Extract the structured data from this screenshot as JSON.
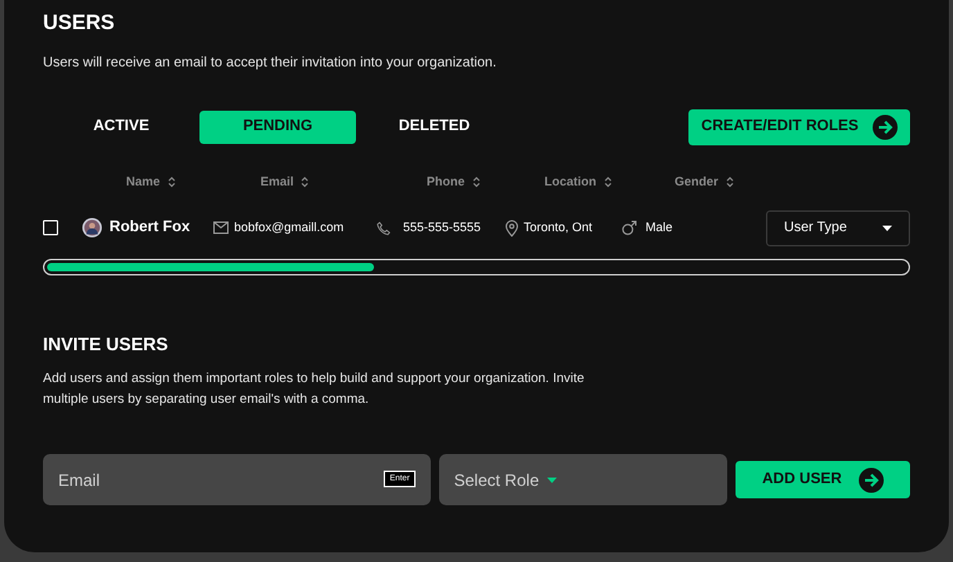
{
  "users": {
    "title": "USERS",
    "description": "Users will receive an email to accept their invitation into your organization."
  },
  "tabs": [
    {
      "label": "ACTIVE",
      "selected": false
    },
    {
      "label": "PENDING",
      "selected": true
    },
    {
      "label": "DELETED",
      "selected": false
    }
  ],
  "roles_button": {
    "label": "CREATE/EDIT ROLES"
  },
  "table": {
    "columns": [
      "Name",
      "Email",
      "Phone",
      "Location",
      "Gender"
    ],
    "rows": [
      {
        "checked": false,
        "name": "Robert Fox",
        "email": "bobfox@gmaill.com",
        "phone": "555-555-5555",
        "location": "Toronto, Ont",
        "gender": "Male",
        "user_type": "User Type"
      }
    ]
  },
  "progress": {
    "level": 0.38
  },
  "invite": {
    "title": "INVITE USERS",
    "description": "Add users and assign them important roles to help build and support your organization. Invite multiple users by separating user email's with a comma.",
    "email_placeholder": "Email",
    "key_hint": "Enter",
    "role_placeholder": "Select Role",
    "button": "ADD USER"
  }
}
